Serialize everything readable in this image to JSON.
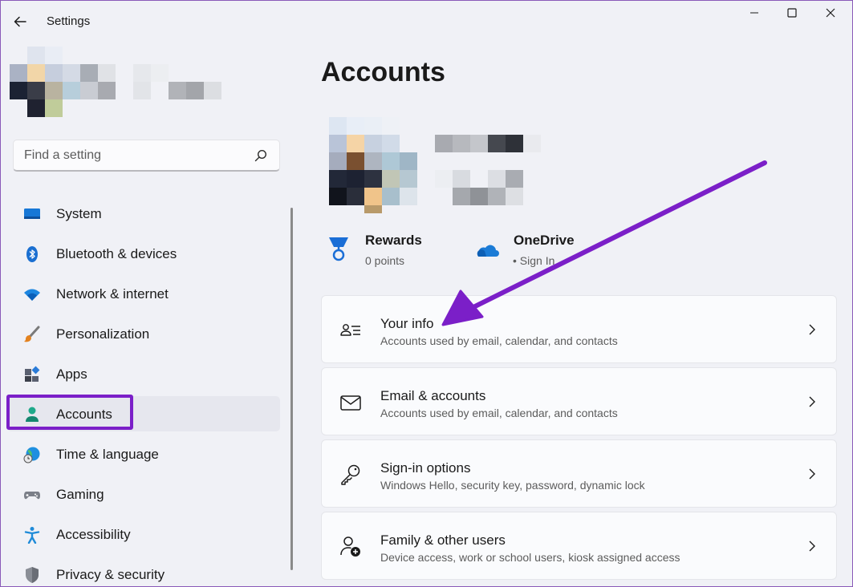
{
  "window": {
    "title": "Settings",
    "accent": "#2a62c9",
    "annotation_color": "#7b1fc8"
  },
  "search": {
    "placeholder": "Find a setting"
  },
  "nav": {
    "items": [
      {
        "label": "System",
        "icon": "monitor-icon"
      },
      {
        "label": "Bluetooth & devices",
        "icon": "bluetooth-icon"
      },
      {
        "label": "Network & internet",
        "icon": "wifi-icon"
      },
      {
        "label": "Personalization",
        "icon": "brush-icon"
      },
      {
        "label": "Apps",
        "icon": "apps-icon"
      },
      {
        "label": "Accounts",
        "icon": "person-icon",
        "active": true
      },
      {
        "label": "Time & language",
        "icon": "globe-clock-icon"
      },
      {
        "label": "Gaming",
        "icon": "gamepad-icon"
      },
      {
        "label": "Accessibility",
        "icon": "accessibility-icon"
      },
      {
        "label": "Privacy & security",
        "icon": "shield-icon"
      }
    ]
  },
  "main": {
    "title": "Accounts",
    "rewards": {
      "title": "Rewards",
      "subtitle": "0 points"
    },
    "onedrive": {
      "title": "OneDrive",
      "subtitle": "• Sign In"
    },
    "cards": [
      {
        "title": "Your info",
        "subtitle": "Accounts used by email, calendar, and contacts",
        "icon": "person-list-icon"
      },
      {
        "title": "Email & accounts",
        "subtitle": "Accounts used by email, calendar, and contacts",
        "icon": "mail-icon"
      },
      {
        "title": "Sign-in options",
        "subtitle": "Windows Hello, security key, password, dynamic lock",
        "icon": "key-icon"
      },
      {
        "title": "Family & other users",
        "subtitle": "Device access, work or school users, kiosk assigned access",
        "icon": "person-add-icon"
      }
    ]
  }
}
